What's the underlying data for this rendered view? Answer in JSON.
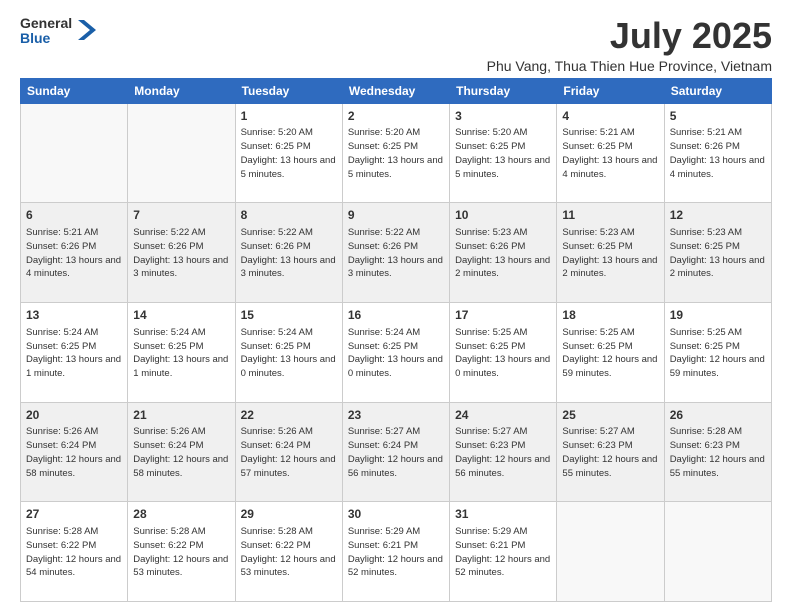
{
  "header": {
    "logo_general": "General",
    "logo_blue": "Blue",
    "month_year": "July 2025",
    "location": "Phu Vang, Thua Thien Hue Province, Vietnam"
  },
  "days_of_week": [
    "Sunday",
    "Monday",
    "Tuesday",
    "Wednesday",
    "Thursday",
    "Friday",
    "Saturday"
  ],
  "weeks": [
    [
      {
        "day": "",
        "info": ""
      },
      {
        "day": "",
        "info": ""
      },
      {
        "day": "1",
        "info": "Sunrise: 5:20 AM\nSunset: 6:25 PM\nDaylight: 13 hours and 5 minutes."
      },
      {
        "day": "2",
        "info": "Sunrise: 5:20 AM\nSunset: 6:25 PM\nDaylight: 13 hours and 5 minutes."
      },
      {
        "day": "3",
        "info": "Sunrise: 5:20 AM\nSunset: 6:25 PM\nDaylight: 13 hours and 5 minutes."
      },
      {
        "day": "4",
        "info": "Sunrise: 5:21 AM\nSunset: 6:25 PM\nDaylight: 13 hours and 4 minutes."
      },
      {
        "day": "5",
        "info": "Sunrise: 5:21 AM\nSunset: 6:26 PM\nDaylight: 13 hours and 4 minutes."
      }
    ],
    [
      {
        "day": "6",
        "info": "Sunrise: 5:21 AM\nSunset: 6:26 PM\nDaylight: 13 hours and 4 minutes."
      },
      {
        "day": "7",
        "info": "Sunrise: 5:22 AM\nSunset: 6:26 PM\nDaylight: 13 hours and 3 minutes."
      },
      {
        "day": "8",
        "info": "Sunrise: 5:22 AM\nSunset: 6:26 PM\nDaylight: 13 hours and 3 minutes."
      },
      {
        "day": "9",
        "info": "Sunrise: 5:22 AM\nSunset: 6:26 PM\nDaylight: 13 hours and 3 minutes."
      },
      {
        "day": "10",
        "info": "Sunrise: 5:23 AM\nSunset: 6:26 PM\nDaylight: 13 hours and 2 minutes."
      },
      {
        "day": "11",
        "info": "Sunrise: 5:23 AM\nSunset: 6:25 PM\nDaylight: 13 hours and 2 minutes."
      },
      {
        "day": "12",
        "info": "Sunrise: 5:23 AM\nSunset: 6:25 PM\nDaylight: 13 hours and 2 minutes."
      }
    ],
    [
      {
        "day": "13",
        "info": "Sunrise: 5:24 AM\nSunset: 6:25 PM\nDaylight: 13 hours and 1 minute."
      },
      {
        "day": "14",
        "info": "Sunrise: 5:24 AM\nSunset: 6:25 PM\nDaylight: 13 hours and 1 minute."
      },
      {
        "day": "15",
        "info": "Sunrise: 5:24 AM\nSunset: 6:25 PM\nDaylight: 13 hours and 0 minutes."
      },
      {
        "day": "16",
        "info": "Sunrise: 5:24 AM\nSunset: 6:25 PM\nDaylight: 13 hours and 0 minutes."
      },
      {
        "day": "17",
        "info": "Sunrise: 5:25 AM\nSunset: 6:25 PM\nDaylight: 13 hours and 0 minutes."
      },
      {
        "day": "18",
        "info": "Sunrise: 5:25 AM\nSunset: 6:25 PM\nDaylight: 12 hours and 59 minutes."
      },
      {
        "day": "19",
        "info": "Sunrise: 5:25 AM\nSunset: 6:25 PM\nDaylight: 12 hours and 59 minutes."
      }
    ],
    [
      {
        "day": "20",
        "info": "Sunrise: 5:26 AM\nSunset: 6:24 PM\nDaylight: 12 hours and 58 minutes."
      },
      {
        "day": "21",
        "info": "Sunrise: 5:26 AM\nSunset: 6:24 PM\nDaylight: 12 hours and 58 minutes."
      },
      {
        "day": "22",
        "info": "Sunrise: 5:26 AM\nSunset: 6:24 PM\nDaylight: 12 hours and 57 minutes."
      },
      {
        "day": "23",
        "info": "Sunrise: 5:27 AM\nSunset: 6:24 PM\nDaylight: 12 hours and 56 minutes."
      },
      {
        "day": "24",
        "info": "Sunrise: 5:27 AM\nSunset: 6:23 PM\nDaylight: 12 hours and 56 minutes."
      },
      {
        "day": "25",
        "info": "Sunrise: 5:27 AM\nSunset: 6:23 PM\nDaylight: 12 hours and 55 minutes."
      },
      {
        "day": "26",
        "info": "Sunrise: 5:28 AM\nSunset: 6:23 PM\nDaylight: 12 hours and 55 minutes."
      }
    ],
    [
      {
        "day": "27",
        "info": "Sunrise: 5:28 AM\nSunset: 6:22 PM\nDaylight: 12 hours and 54 minutes."
      },
      {
        "day": "28",
        "info": "Sunrise: 5:28 AM\nSunset: 6:22 PM\nDaylight: 12 hours and 53 minutes."
      },
      {
        "day": "29",
        "info": "Sunrise: 5:28 AM\nSunset: 6:22 PM\nDaylight: 12 hours and 53 minutes."
      },
      {
        "day": "30",
        "info": "Sunrise: 5:29 AM\nSunset: 6:21 PM\nDaylight: 12 hours and 52 minutes."
      },
      {
        "day": "31",
        "info": "Sunrise: 5:29 AM\nSunset: 6:21 PM\nDaylight: 12 hours and 52 minutes."
      },
      {
        "day": "",
        "info": ""
      },
      {
        "day": "",
        "info": ""
      }
    ]
  ]
}
